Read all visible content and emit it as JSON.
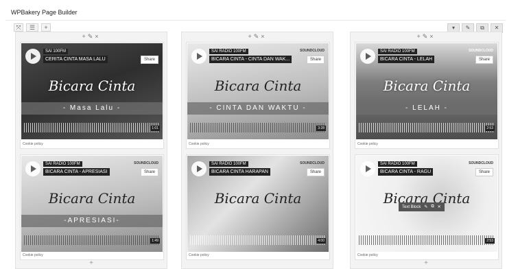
{
  "window": {
    "title": "WPBakery Page Builder"
  },
  "toolbar": {
    "left_icons": [
      "drag-icon",
      "layout-icon",
      "add-icon"
    ],
    "right_icons": [
      "toggle-icon",
      "edit-icon",
      "clone-icon",
      "close-icon"
    ],
    "col_controls": "+✎×",
    "add_plus": "+"
  },
  "cards": [
    {
      "artist": "SAI 100FM",
      "track": "CERITA CINTA MASA LALU",
      "script": "Bicara Cinta",
      "band": "- Masa Lalu -",
      "share": "Share",
      "duration": "1:01",
      "cookie": "Cookie policy",
      "soundcloud": ""
    },
    {
      "artist": "SAI RADIO 100FM",
      "track": "BICARA CINTA - CINTA DAN WAK...",
      "script": "Bicara Cinta",
      "band": "- CINTA DAN WAKTU -",
      "share": "Share",
      "duration": "3:28",
      "cookie": "Cookie policy",
      "soundcloud": "SOUNDCLOUD"
    },
    {
      "artist": "SAI RADIO 100FM",
      "track": "BICARA CINTA - LELAH",
      "script": "Bicara Cinta",
      "band": "- LELAH -",
      "share": "Share",
      "duration": "2:53",
      "cookie": "Cookie policy",
      "soundcloud": "SOUNDCLOUD"
    },
    {
      "artist": "SAI RADIO 100FM",
      "track": "BICARA CINTA - APRESIASI",
      "script": "Bicara Cinta",
      "band": "-APRESIASI-",
      "share": "Share",
      "duration": "1:49",
      "cookie": "Cookie policy",
      "soundcloud": "SOUNDCLOUD"
    },
    {
      "artist": "SAI RADIO 100FM",
      "track": "BICARA CINTA HARAPAN",
      "script": "Bicara Cinta",
      "band": "",
      "share": "Share",
      "duration": "4:00",
      "cookie": "Cookie policy",
      "soundcloud": "SOUNDCLOUD"
    },
    {
      "artist": "SAI RADIO 100FM",
      "track": "BICARA CINTA - RAGU",
      "script": "Bicara Cinta",
      "band": "",
      "share": "Share",
      "duration": "2:53",
      "cookie": "Cookie policy",
      "soundcloud": "SOUNDCLOUD"
    }
  ],
  "text_block_label": "Text Block"
}
